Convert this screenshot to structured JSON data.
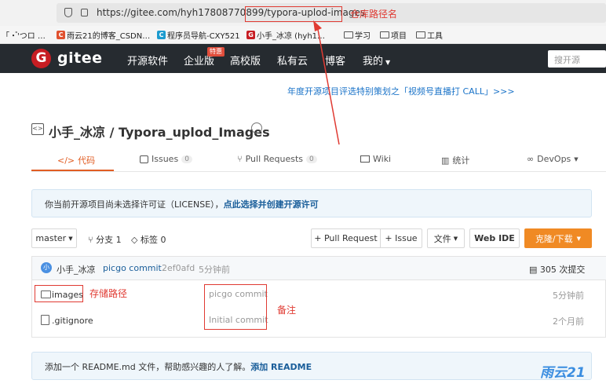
{
  "browser": {
    "url": "https://gitee.com/hyh17808770899/typora-uplod-images",
    "bookmarks": [
      {
        "label": "「・゚'つロ …",
        "icon": "",
        "color": "#000000"
      },
      {
        "label": "雨云21的博客_CSDN…",
        "icon": "C",
        "color": "#e0512f"
      },
      {
        "label": "程序员导航-CXY521",
        "icon": "C",
        "color": "#1c9bcf"
      },
      {
        "label": "小手_冰凉 (hyh1…",
        "icon": "G",
        "color": "#c71d23"
      },
      {
        "label": "学习",
        "icon": "folder-icon"
      },
      {
        "label": "项目",
        "icon": "folder-icon"
      },
      {
        "label": "工具",
        "icon": "folder-icon"
      }
    ]
  },
  "nav": {
    "logo_text": "gitee",
    "items": [
      "开源软件",
      "企业版",
      "高校版",
      "私有云",
      "博客",
      "我的"
    ],
    "badge": "特惠",
    "search_placeholder": "搜开源"
  },
  "banner": {
    "text": "年度开源项目评选特别策划之「视频号直播打 CALL」>>>"
  },
  "repo": {
    "title": "小手_冰凉 / Typora_uplod_Images"
  },
  "tabs": [
    {
      "label": "代码",
      "count": ""
    },
    {
      "label": "Issues",
      "count": "0"
    },
    {
      "label": "Pull Requests",
      "count": "0"
    },
    {
      "label": "Wiki",
      "count": ""
    },
    {
      "label": "统计",
      "count": ""
    },
    {
      "label": "DevOps",
      "count": ""
    }
  ],
  "license_notice": {
    "text": "你当前开源项目尚未选择许可证（LICENSE），",
    "action": "点此选择并创建开源许可"
  },
  "toolbar": {
    "branch": "master",
    "branches": "分支 1",
    "tags": "标签 0",
    "pull_request": "+ Pull Request",
    "issue": "+ Issue",
    "file": "文件",
    "webide": "Web IDE",
    "clone": "克隆/下载"
  },
  "latest_commit": {
    "author": "小手_冰凉",
    "avatar_text": "小",
    "message": "picgo commit",
    "hash": "2ef0afd",
    "time": "5分钟前",
    "total_commits": "305 次提交"
  },
  "files": [
    {
      "name": "images",
      "type": "folder",
      "message": "picgo commit",
      "time": "5分钟前"
    },
    {
      "name": ".gitignore",
      "type": "file",
      "message": "Initial commit",
      "time": "2个月前"
    }
  ],
  "readme_notice": {
    "text": "添加一个 README.md 文件，帮助感兴趣的人了解。",
    "action": "添加 README"
  },
  "annotations": {
    "repo_name": "仓库路径名",
    "storage_path": "存储路径",
    "remark": "备注",
    "color": "#e03a32"
  },
  "watermark": "雨云21",
  "colors": {
    "accent": "#e15d23",
    "nav_bg": "#262b30",
    "link": "#1a73c8"
  }
}
